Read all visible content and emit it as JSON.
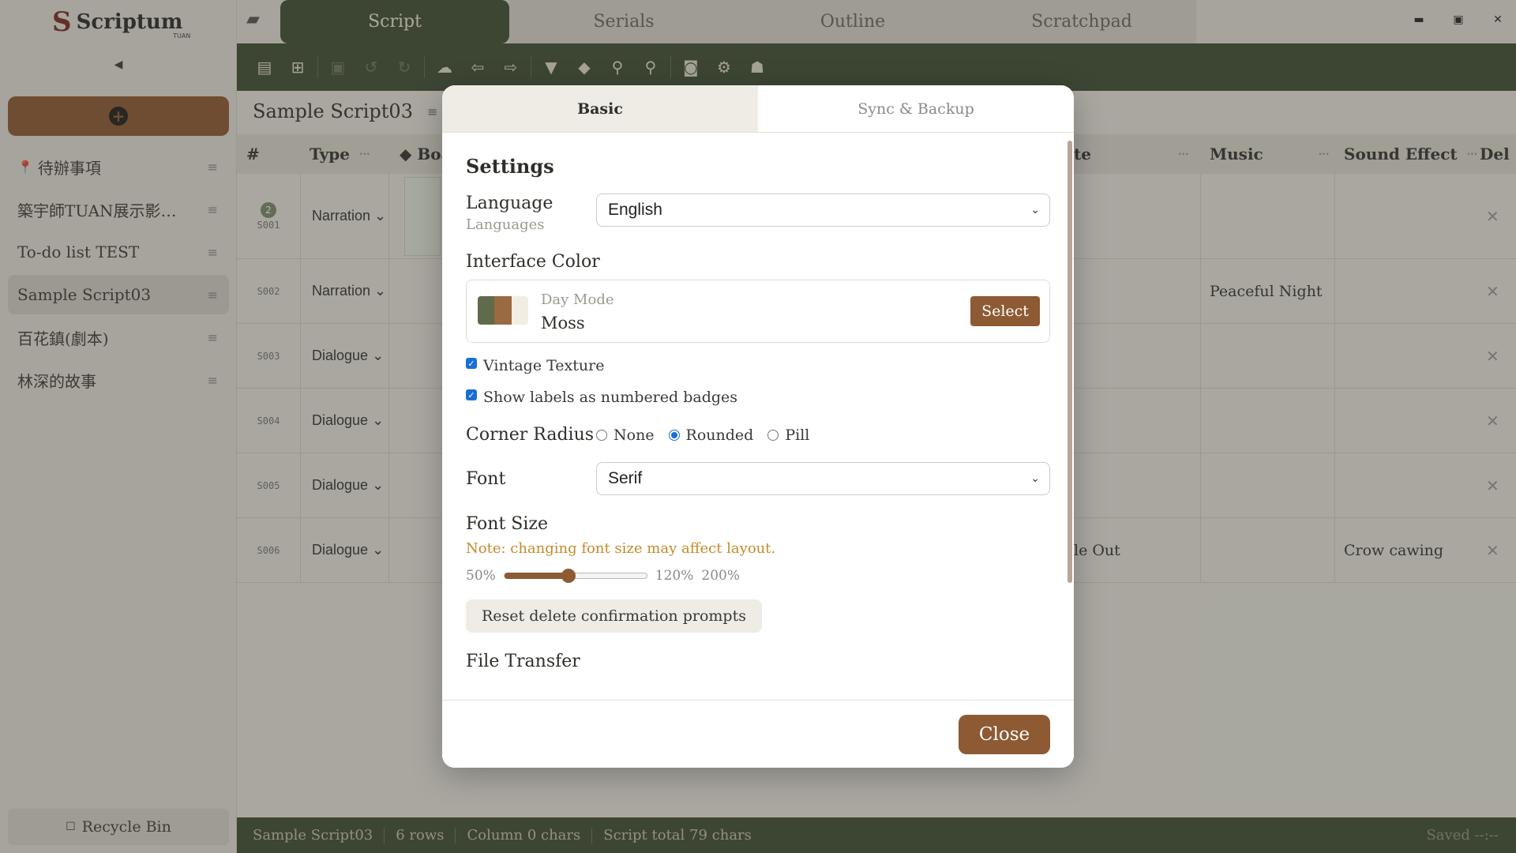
{
  "app": {
    "name": "Scriptum",
    "sub": "TUAN"
  },
  "sidebar": {
    "items": [
      {
        "label": "待辦事項",
        "pinned": true
      },
      {
        "label": "築宇師TUAN展示影…"
      },
      {
        "label": "To-do list TEST"
      },
      {
        "label": "Sample Script03",
        "active": true
      },
      {
        "label": "百花鎮(劇本)"
      },
      {
        "label": "林深的故事"
      }
    ],
    "recycle_label": "Recycle Bin"
  },
  "tabs": [
    "Script",
    "Serials",
    "Outline",
    "Scratchpad"
  ],
  "script": {
    "title": "Sample Script03",
    "columns": {
      "num": "#",
      "type": "Type",
      "board": "◆ Boa",
      "note": "te",
      "music": "Music",
      "sfx": "Sound Effect",
      "del": "Del"
    },
    "rows": [
      {
        "id": "S001",
        "badge": "2",
        "type": "Narration",
        "note": "",
        "music": "",
        "sfx": ""
      },
      {
        "id": "S002",
        "badge": "",
        "type": "Narration",
        "note": "",
        "music": "Peaceful Night",
        "sfx": ""
      },
      {
        "id": "S003",
        "badge": "",
        "type": "Dialogue",
        "note": "",
        "music": "",
        "sfx": ""
      },
      {
        "id": "S004",
        "badge": "",
        "type": "Dialogue",
        "note": "",
        "music": "",
        "sfx": ""
      },
      {
        "id": "S005",
        "badge": "",
        "type": "Dialogue",
        "note": "",
        "music": "",
        "sfx": ""
      },
      {
        "id": "S006",
        "badge": "",
        "type": "Dialogue",
        "note": "le Out",
        "music": "",
        "sfx": "Crow cawing"
      }
    ]
  },
  "status": {
    "doc": "Sample Script03",
    "rows": "6 rows",
    "column_chars": "Column 0 chars",
    "total": "Script total 79 chars",
    "saved": "Saved --:--"
  },
  "modal": {
    "tabs": [
      "Basic",
      "Sync & Backup"
    ],
    "heading": "Settings",
    "language": {
      "label": "Language",
      "sub": "Languages",
      "value": "English"
    },
    "interface_color": {
      "label": "Interface Color",
      "mode": "Day Mode",
      "name": "Moss",
      "select_label": "Select",
      "swatches": [
        "#5f6b4a",
        "#9a6a40",
        "#f1ede2"
      ]
    },
    "vintage_texture": {
      "label": "Vintage Texture",
      "checked": true
    },
    "numbered_badges": {
      "label": "Show labels as numbered badges",
      "checked": true
    },
    "corner_radius": {
      "label": "Corner Radius",
      "options": [
        "None",
        "Rounded",
        "Pill"
      ],
      "selected": "Rounded"
    },
    "font": {
      "label": "Font",
      "value": "Serif"
    },
    "font_size": {
      "label": "Font Size",
      "note": "Note: changing font size may affect layout.",
      "min": "50%",
      "current": "120%",
      "max": "200%",
      "value_fraction": 0.45
    },
    "reset_label": "Reset delete confirmation prompts",
    "file_transfer_label": "File Transfer",
    "close_label": "Close"
  },
  "colors": {
    "accent": "#8d5a34",
    "dark": "#3e4d35",
    "note": "#c58a2c"
  }
}
